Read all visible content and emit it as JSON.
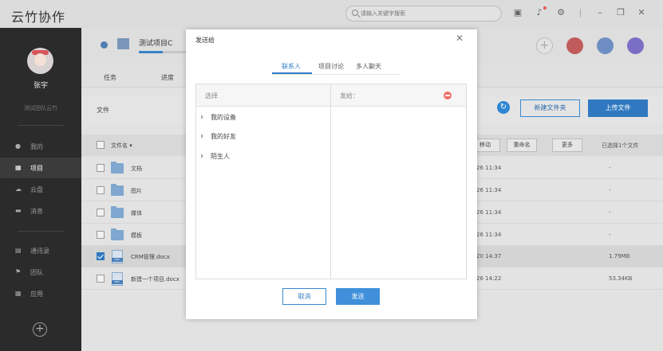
{
  "app": {
    "title": "云竹协作",
    "search_placeholder": "请输入关键字搜索"
  },
  "titlebar_icons": [
    "briefcase-icon",
    "bell-icon",
    "gear-icon",
    "minimize-icon",
    "restore-icon",
    "close-icon"
  ],
  "sidebar": {
    "user_name": "张宇",
    "team": "测试团队云竹",
    "items": [
      {
        "label": "我的",
        "icon": "person-icon",
        "active": false
      },
      {
        "label": "项目",
        "icon": "project-icon",
        "active": true
      },
      {
        "label": "云盘",
        "icon": "cloud-icon",
        "active": false
      },
      {
        "label": "消息",
        "icon": "message-icon",
        "active": false
      },
      {
        "label": "通讯录",
        "icon": "contacts-icon",
        "active": false
      },
      {
        "label": "团队",
        "icon": "flag-icon",
        "active": false
      },
      {
        "label": "应用",
        "icon": "apps-icon",
        "active": false
      }
    ],
    "add_symbol": "+"
  },
  "project": {
    "name": "测试项目C",
    "progress_fraction": 0.5,
    "tabs": [
      "任务",
      "进度"
    ]
  },
  "files": {
    "section_title": "文件",
    "new_folder_label": "新建文件夹",
    "upload_label": "上传文件",
    "header": {
      "name": "文件名 ▾",
      "move": "移动",
      "rename": "重命名",
      "more": "更多",
      "selected": "已选择1个文件"
    },
    "rows": [
      {
        "name": "文档",
        "date": "26 11:34",
        "size": "-",
        "type": "folder",
        "checked": false
      },
      {
        "name": "图片",
        "date": "26 11:34",
        "size": "-",
        "type": "folder",
        "checked": false
      },
      {
        "name": "媒体",
        "date": "26 11:34",
        "size": "-",
        "type": "folder",
        "checked": false
      },
      {
        "name": "模板",
        "date": "26 11:34",
        "size": "-",
        "type": "folder",
        "checked": false
      },
      {
        "name": "CRM管理.docx",
        "date": "20 14:37",
        "size": "1.79MB",
        "type": "doc",
        "checked": true
      },
      {
        "name": "新建一个项目.docx",
        "date": "26 14:22",
        "size": "53.34KB",
        "type": "doc",
        "checked": false
      }
    ]
  },
  "dialog": {
    "title": "发送给",
    "close": "✕",
    "tabs": [
      "联系人",
      "项目讨论",
      "多人聊天"
    ],
    "active_tab": 0,
    "left_title": "选择",
    "tree": [
      "我的设备",
      "我的好友",
      "陌生人"
    ],
    "right_title": "发给：",
    "cancel_label": "取消",
    "send_label": "发送"
  },
  "colors": {
    "accent": "#3079c0",
    "sidebar_bg": "#2b2b2b",
    "remove_red": "#f27067"
  }
}
